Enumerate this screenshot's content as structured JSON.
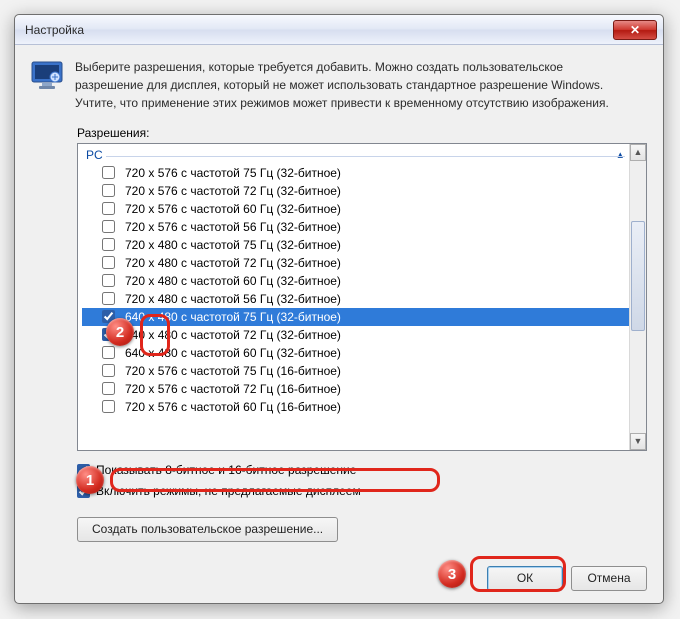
{
  "window": {
    "title": "Настройка",
    "close_icon": "✕"
  },
  "intro": {
    "line1": "Выберите разрешения, которые требуется добавить. Можно создать пользовательское",
    "line2": "разрешение для дисплея, который не может использовать стандартное разрешение Windows.",
    "line3": "Учтите, что применение этих режимов может привести к временному отсутствию изображения."
  },
  "list": {
    "label": "Разрешения:",
    "group": "PC",
    "collapse_glyph": "▴",
    "items": [
      {
        "label": "720 x 576 с частотой 75 Гц (32-битное)",
        "checked": false,
        "selected": false
      },
      {
        "label": "720 x 576 с частотой 72 Гц (32-битное)",
        "checked": false,
        "selected": false
      },
      {
        "label": "720 x 576 с частотой 60 Гц (32-битное)",
        "checked": false,
        "selected": false
      },
      {
        "label": "720 x 576 с частотой 56 Гц (32-битное)",
        "checked": false,
        "selected": false
      },
      {
        "label": "720 x 480 с частотой 75 Гц (32-битное)",
        "checked": false,
        "selected": false
      },
      {
        "label": "720 x 480 с частотой 72 Гц (32-битное)",
        "checked": false,
        "selected": false
      },
      {
        "label": "720 x 480 с частотой 60 Гц (32-битное)",
        "checked": false,
        "selected": false
      },
      {
        "label": "720 x 480 с частотой 56 Гц (32-битное)",
        "checked": false,
        "selected": false
      },
      {
        "label": "640 x 480 с частотой 75 Гц (32-битное)",
        "checked": true,
        "selected": true
      },
      {
        "label": "640 x 480 с частотой 72 Гц (32-битное)",
        "checked": true,
        "selected": false
      },
      {
        "label": "640 x 480 с частотой 60 Гц (32-битное)",
        "checked": false,
        "selected": false
      },
      {
        "label": "720 x 576 с частотой 75 Гц (16-битное)",
        "checked": false,
        "selected": false
      },
      {
        "label": "720 x 576 с частотой 72 Гц (16-битное)",
        "checked": false,
        "selected": false
      },
      {
        "label": "720 x 576 с частотой 60 Гц (16-битное)",
        "checked": false,
        "selected": false
      }
    ],
    "scroll_up_glyph": "▲",
    "scroll_down_glyph": "▼"
  },
  "options": {
    "show_8_16": {
      "label": "Показывать 8-битное и 16-битное разрешение",
      "checked": true
    },
    "include_unlisted": {
      "label": "Включить режимы, не предлагаемые дисплеем",
      "checked": true
    }
  },
  "buttons": {
    "create_custom": "Создать пользовательское разрешение...",
    "ok": "ОК",
    "cancel": "Отмена"
  },
  "annotations": {
    "b1": "1",
    "b2": "2",
    "b3": "3"
  }
}
